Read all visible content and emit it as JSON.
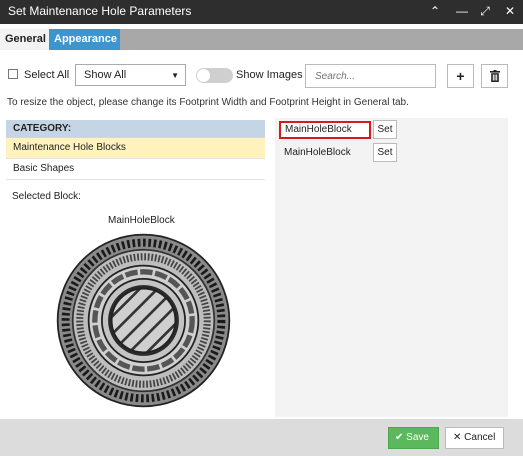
{
  "window": {
    "title": "Set Maintenance Hole Parameters"
  },
  "tabs": [
    {
      "label": "General"
    },
    {
      "label": "Appearance"
    }
  ],
  "toolbar": {
    "select_all_label": "Select All",
    "show_select_value": "Show All",
    "show_images_label": "Show Images",
    "search_placeholder": "Search...",
    "add_icon": "plus-icon",
    "delete_icon": "trash-icon"
  },
  "hint": "To resize the object, please change its Footprint Width and Footprint Height in General tab.",
  "category": {
    "header": "CATEGORY:",
    "items": [
      {
        "label": "Maintenance Hole Blocks"
      },
      {
        "label": "Basic Shapes"
      }
    ]
  },
  "selected_block": {
    "label": "Selected Block:",
    "name": "MainHoleBlock"
  },
  "blocks": [
    {
      "name": "MainHoleBlock",
      "set_label": "Set"
    },
    {
      "name": "MainHoleBlock",
      "set_label": "Set"
    }
  ],
  "footer": {
    "save_label": "Save",
    "cancel_label": "Cancel"
  },
  "colors": {
    "titlebar": "#2e2e2e",
    "active_tab": "#3b95cf",
    "category_header": "#c5d5e5",
    "selected_item": "#fff2bd",
    "highlight_border": "#d41a1a",
    "save_button": "#5cb85c"
  }
}
